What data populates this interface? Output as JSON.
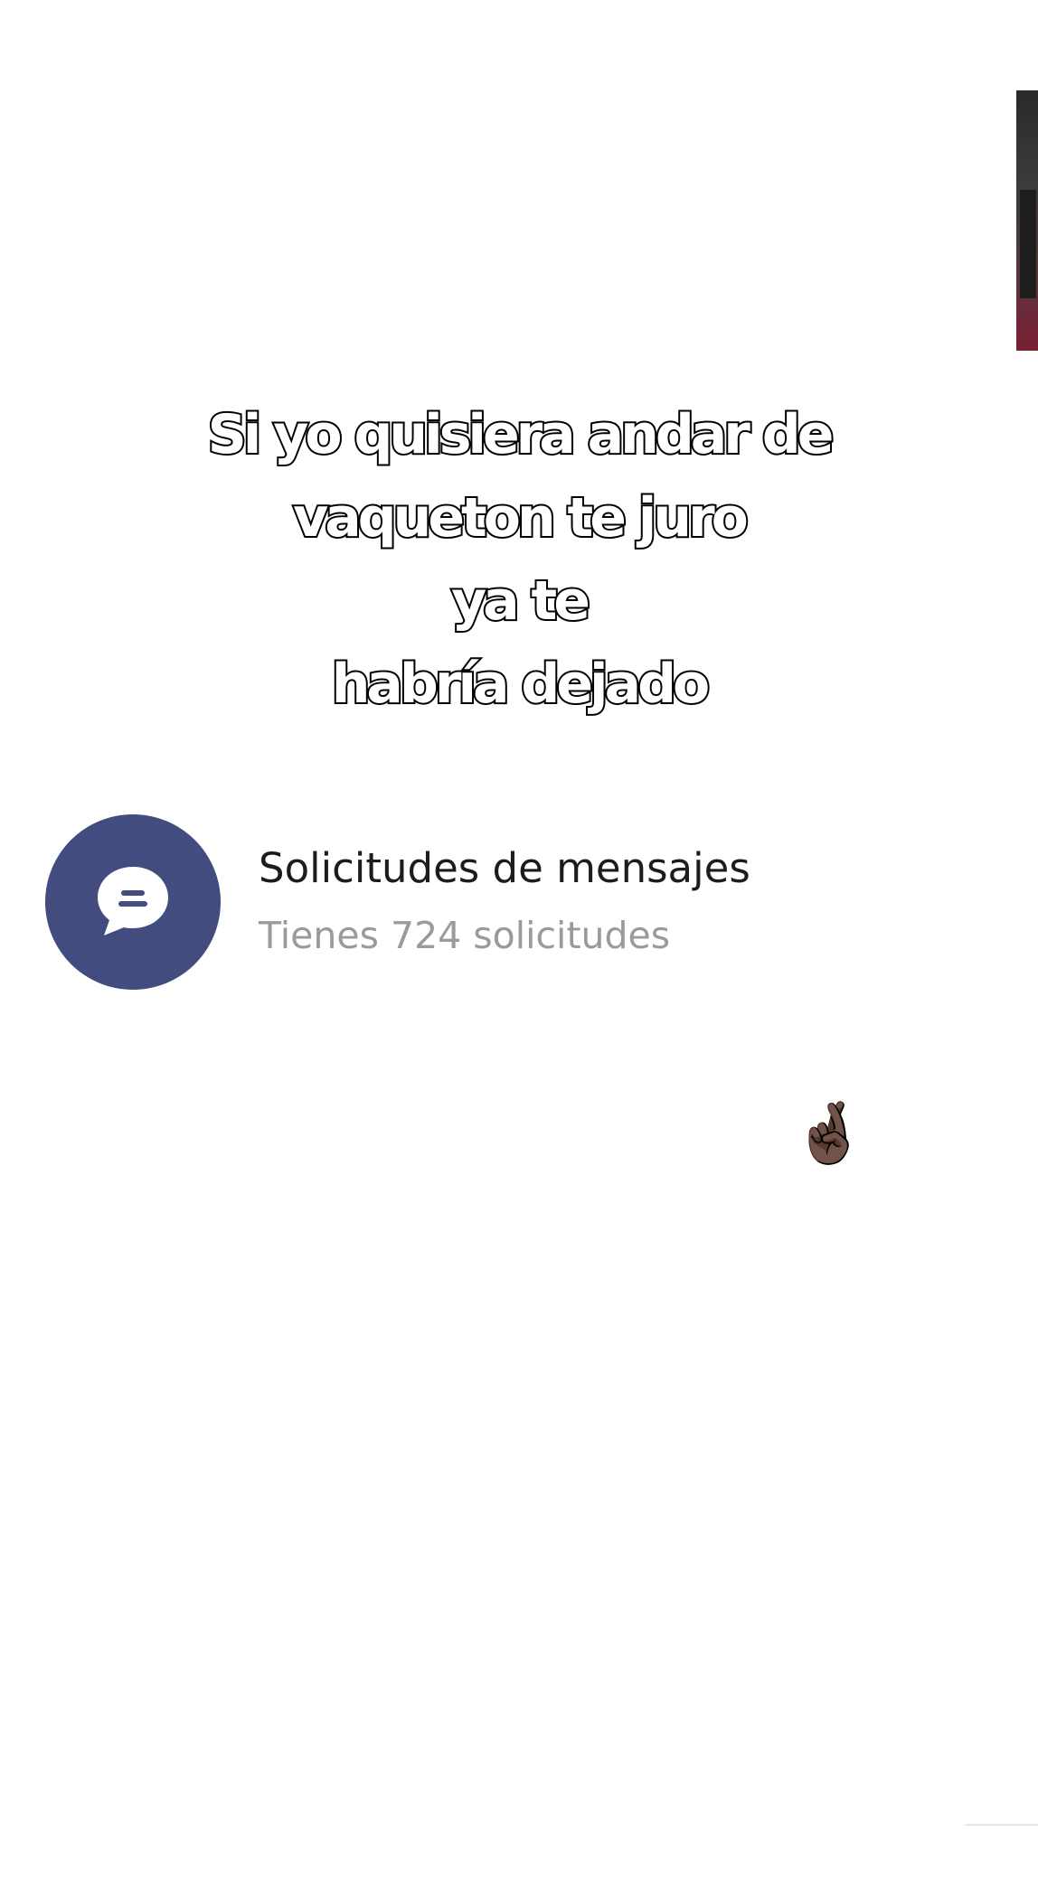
{
  "caption": {
    "lines": [
      "Si yo quisiera andar de",
      "vaqueton te juro",
      "ya te",
      "habría dejado"
    ]
  },
  "message_requests": {
    "title": "Solicitudes de mensajes",
    "subtitle": "Tienes 724 solicitudes",
    "icon": "chat-bubble-icon",
    "avatar_color": "#434c7e"
  },
  "sticker": {
    "emoji": "🤞🏿"
  }
}
